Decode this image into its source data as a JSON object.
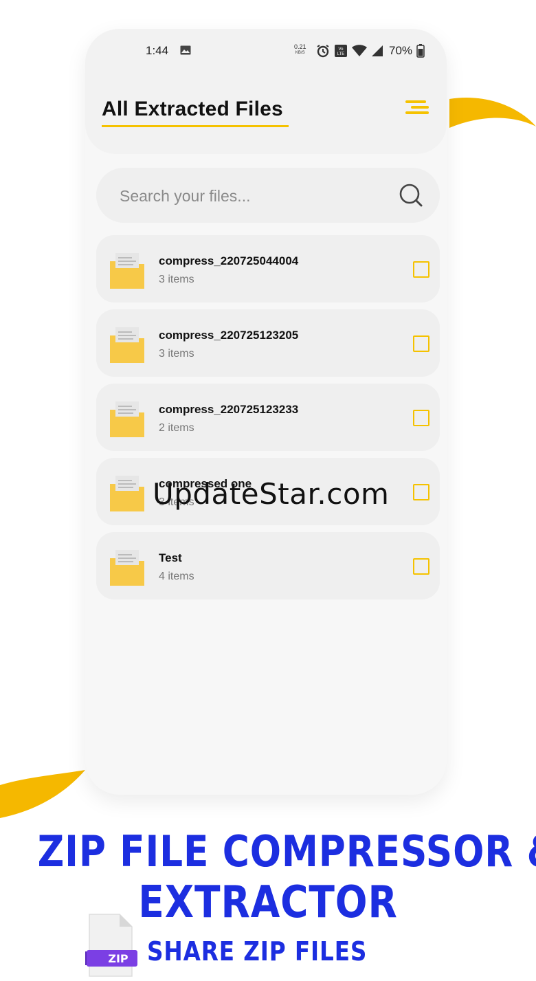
{
  "status_bar": {
    "time": "1:44",
    "network_speed": "0.21",
    "network_speed_unit": "KB/S",
    "volte_label": "VoLTE",
    "battery": "70%"
  },
  "header": {
    "title": "All Extracted Files"
  },
  "search": {
    "placeholder": "Search your files...",
    "value": ""
  },
  "files": [
    {
      "name": "compress_220725044004",
      "count": "3 items"
    },
    {
      "name": "compress_220725123205",
      "count": "3 items"
    },
    {
      "name": "compress_220725123233",
      "count": "2 items"
    },
    {
      "name": "compressed one",
      "count": "3 items"
    },
    {
      "name": "Test",
      "count": "4 items"
    }
  ],
  "watermark": "UpdateStar.com",
  "promo": {
    "line1": "ZIP FILE COMPRESSOR &",
    "line2": "EXTRACTOR",
    "line3": "SHARE ZIP FILES",
    "zip_icon_label": "ZIP"
  },
  "colors": {
    "accent_yellow": "#F5C200",
    "promo_blue": "#1C2EE0",
    "zip_purple": "#7B3FE4"
  },
  "icons": {
    "menu": "menu-icon",
    "search": "search-icon",
    "folder": "folder-icon",
    "checkbox": "checkbox-icon"
  }
}
